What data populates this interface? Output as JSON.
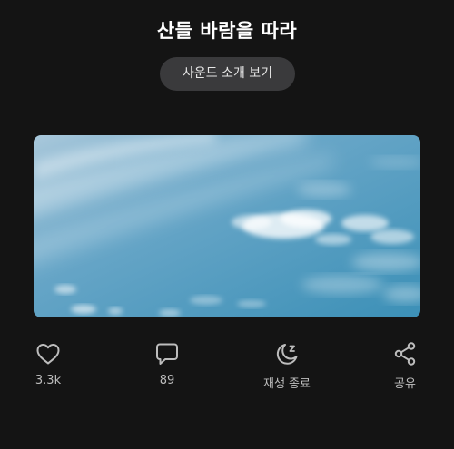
{
  "title": "산들 바람을 따라",
  "intro_button": "사운드 소개 보기",
  "cover_image": "blue-sky-with-clouds",
  "actions": {
    "like": {
      "icon": "heart-icon",
      "label": "3.3k"
    },
    "comment": {
      "icon": "comment-icon",
      "label": "89"
    },
    "sleep_timer": {
      "icon": "moon-sleep-icon",
      "label": "재생 종료"
    },
    "share": {
      "icon": "share-icon",
      "label": "공유"
    }
  },
  "colors": {
    "background": "#141414",
    "button_bg": "#3a3a3c",
    "icon": "#bdbdbd",
    "sky_top": "#8fb9d4",
    "sky_bottom": "#3f93b9"
  }
}
